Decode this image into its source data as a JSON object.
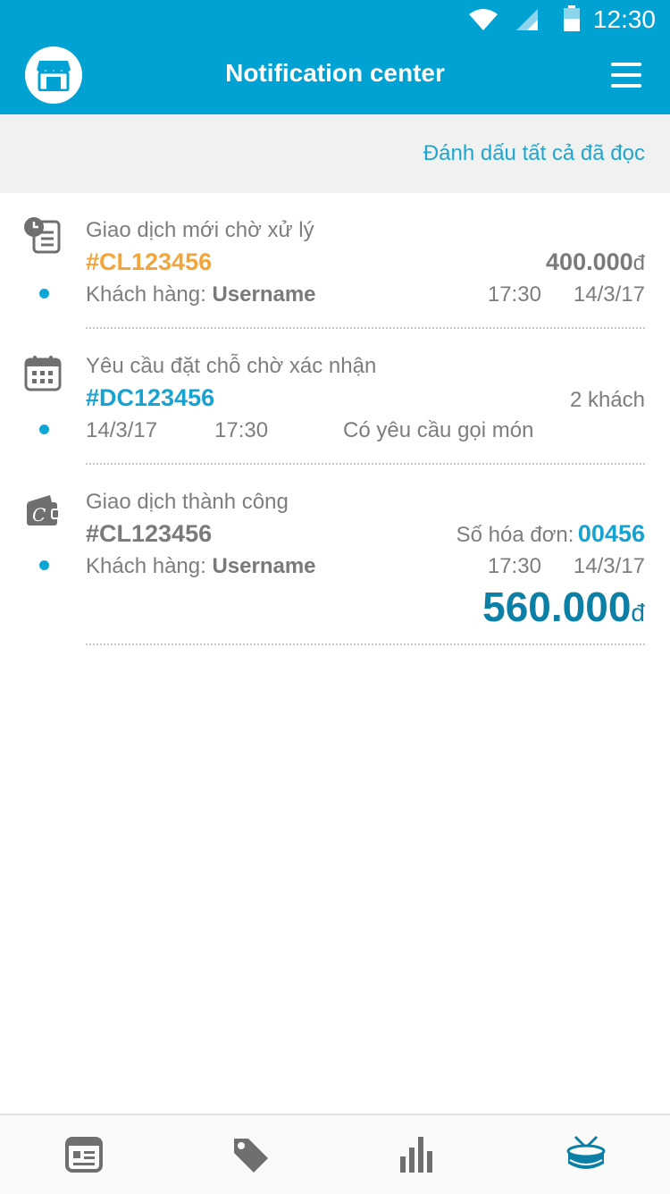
{
  "status_bar": {
    "time": "12:30"
  },
  "app_bar": {
    "title": "Notification center"
  },
  "sub_bar": {
    "mark_all_read": "Đánh dấu tất cả đã đọc"
  },
  "notifications": [
    {
      "icon": "pending-receipt-icon",
      "title": "Giao dịch mới chờ xử lý",
      "code": "#CL123456",
      "amount": "400.000",
      "currency": "đ",
      "customer_label": "Khách hàng:",
      "customer_name": "Username",
      "time": "17:30",
      "date": "14/3/17",
      "unread": true
    },
    {
      "icon": "calendar-icon",
      "title": "Yêu cầu đặt chỗ chờ xác nhận",
      "code": "#DC123456",
      "guests": "2 khách",
      "date": "14/3/17",
      "time": "17:30",
      "note": "Có yêu cầu gọi món",
      "unread": true
    },
    {
      "icon": "wallet-icon",
      "title": "Giao dịch thành công",
      "code": "#CL123456",
      "invoice_label": "Số hóa đơn:",
      "invoice_number": "00456",
      "customer_label": "Khách hàng:",
      "customer_name": "Username",
      "time": "17:30",
      "date": "14/3/17",
      "amount": "560.000",
      "currency": "đ",
      "unread": true
    }
  ],
  "bottom_nav": [
    "news-icon",
    "tag-icon",
    "bar-chart-icon",
    "drum-icon"
  ],
  "colors": {
    "primary": "#00a2d4",
    "accent_orange": "#f2a53a",
    "dark_blue": "#0b7fa6"
  }
}
